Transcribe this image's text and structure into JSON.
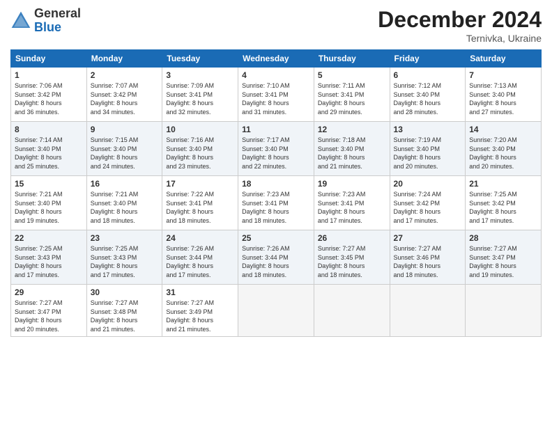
{
  "header": {
    "logo_general": "General",
    "logo_blue": "Blue",
    "month_title": "December 2024",
    "location": "Ternivka, Ukraine"
  },
  "days_of_week": [
    "Sunday",
    "Monday",
    "Tuesday",
    "Wednesday",
    "Thursday",
    "Friday",
    "Saturday"
  ],
  "weeks": [
    [
      {
        "day": "1",
        "info": "Sunrise: 7:06 AM\nSunset: 3:42 PM\nDaylight: 8 hours\nand 36 minutes."
      },
      {
        "day": "2",
        "info": "Sunrise: 7:07 AM\nSunset: 3:42 PM\nDaylight: 8 hours\nand 34 minutes."
      },
      {
        "day": "3",
        "info": "Sunrise: 7:09 AM\nSunset: 3:41 PM\nDaylight: 8 hours\nand 32 minutes."
      },
      {
        "day": "4",
        "info": "Sunrise: 7:10 AM\nSunset: 3:41 PM\nDaylight: 8 hours\nand 31 minutes."
      },
      {
        "day": "5",
        "info": "Sunrise: 7:11 AM\nSunset: 3:41 PM\nDaylight: 8 hours\nand 29 minutes."
      },
      {
        "day": "6",
        "info": "Sunrise: 7:12 AM\nSunset: 3:40 PM\nDaylight: 8 hours\nand 28 minutes."
      },
      {
        "day": "7",
        "info": "Sunrise: 7:13 AM\nSunset: 3:40 PM\nDaylight: 8 hours\nand 27 minutes."
      }
    ],
    [
      {
        "day": "8",
        "info": "Sunrise: 7:14 AM\nSunset: 3:40 PM\nDaylight: 8 hours\nand 25 minutes."
      },
      {
        "day": "9",
        "info": "Sunrise: 7:15 AM\nSunset: 3:40 PM\nDaylight: 8 hours\nand 24 minutes."
      },
      {
        "day": "10",
        "info": "Sunrise: 7:16 AM\nSunset: 3:40 PM\nDaylight: 8 hours\nand 23 minutes."
      },
      {
        "day": "11",
        "info": "Sunrise: 7:17 AM\nSunset: 3:40 PM\nDaylight: 8 hours\nand 22 minutes."
      },
      {
        "day": "12",
        "info": "Sunrise: 7:18 AM\nSunset: 3:40 PM\nDaylight: 8 hours\nand 21 minutes."
      },
      {
        "day": "13",
        "info": "Sunrise: 7:19 AM\nSunset: 3:40 PM\nDaylight: 8 hours\nand 20 minutes."
      },
      {
        "day": "14",
        "info": "Sunrise: 7:20 AM\nSunset: 3:40 PM\nDaylight: 8 hours\nand 20 minutes."
      }
    ],
    [
      {
        "day": "15",
        "info": "Sunrise: 7:21 AM\nSunset: 3:40 PM\nDaylight: 8 hours\nand 19 minutes."
      },
      {
        "day": "16",
        "info": "Sunrise: 7:21 AM\nSunset: 3:40 PM\nDaylight: 8 hours\nand 18 minutes."
      },
      {
        "day": "17",
        "info": "Sunrise: 7:22 AM\nSunset: 3:41 PM\nDaylight: 8 hours\nand 18 minutes."
      },
      {
        "day": "18",
        "info": "Sunrise: 7:23 AM\nSunset: 3:41 PM\nDaylight: 8 hours\nand 18 minutes."
      },
      {
        "day": "19",
        "info": "Sunrise: 7:23 AM\nSunset: 3:41 PM\nDaylight: 8 hours\nand 17 minutes."
      },
      {
        "day": "20",
        "info": "Sunrise: 7:24 AM\nSunset: 3:42 PM\nDaylight: 8 hours\nand 17 minutes."
      },
      {
        "day": "21",
        "info": "Sunrise: 7:25 AM\nSunset: 3:42 PM\nDaylight: 8 hours\nand 17 minutes."
      }
    ],
    [
      {
        "day": "22",
        "info": "Sunrise: 7:25 AM\nSunset: 3:43 PM\nDaylight: 8 hours\nand 17 minutes."
      },
      {
        "day": "23",
        "info": "Sunrise: 7:25 AM\nSunset: 3:43 PM\nDaylight: 8 hours\nand 17 minutes."
      },
      {
        "day": "24",
        "info": "Sunrise: 7:26 AM\nSunset: 3:44 PM\nDaylight: 8 hours\nand 17 minutes."
      },
      {
        "day": "25",
        "info": "Sunrise: 7:26 AM\nSunset: 3:44 PM\nDaylight: 8 hours\nand 18 minutes."
      },
      {
        "day": "26",
        "info": "Sunrise: 7:27 AM\nSunset: 3:45 PM\nDaylight: 8 hours\nand 18 minutes."
      },
      {
        "day": "27",
        "info": "Sunrise: 7:27 AM\nSunset: 3:46 PM\nDaylight: 8 hours\nand 18 minutes."
      },
      {
        "day": "28",
        "info": "Sunrise: 7:27 AM\nSunset: 3:47 PM\nDaylight: 8 hours\nand 19 minutes."
      }
    ],
    [
      {
        "day": "29",
        "info": "Sunrise: 7:27 AM\nSunset: 3:47 PM\nDaylight: 8 hours\nand 20 minutes."
      },
      {
        "day": "30",
        "info": "Sunrise: 7:27 AM\nSunset: 3:48 PM\nDaylight: 8 hours\nand 21 minutes."
      },
      {
        "day": "31",
        "info": "Sunrise: 7:27 AM\nSunset: 3:49 PM\nDaylight: 8 hours\nand 21 minutes."
      },
      {
        "day": "",
        "info": ""
      },
      {
        "day": "",
        "info": ""
      },
      {
        "day": "",
        "info": ""
      },
      {
        "day": "",
        "info": ""
      }
    ]
  ]
}
